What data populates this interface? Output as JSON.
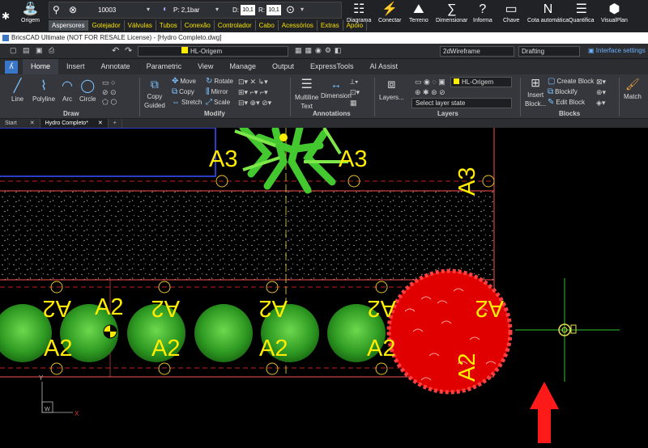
{
  "plugin": {
    "origem": "Origem",
    "pressure": "P: 2,1bar",
    "d_label": "D:",
    "d_val": "10,1",
    "r_label": "R:",
    "r_val": "10,1",
    "code": "10003",
    "tabs": [
      "Aspersores",
      "Gotejador",
      "Válvulas",
      "Tubos",
      "Conexão",
      "Controlador",
      "Cabo",
      "Acessórios",
      "Extras",
      "Apoio"
    ],
    "buttons": [
      "Diagrama",
      "Conectar",
      "Terreno",
      "Dimensionar",
      "Informa",
      "Chave",
      "Cota automática",
      "Quantifica",
      "VisualPlan"
    ]
  },
  "window_title": "BricsCAD Ultimate (NOT FOR RESALE License) - [Hydro Completo.dwg]",
  "qat": {
    "layer": "HL-Origem",
    "visual_style": "2dWireframe",
    "workspace": "Drafting",
    "interface": "Interface settings"
  },
  "ribbon_tabs": [
    "Home",
    "Insert",
    "Annotate",
    "Parametric",
    "View",
    "Manage",
    "Output",
    "ExpressTools",
    "AI Assist"
  ],
  "ribbon": {
    "draw": {
      "label": "Draw",
      "items": [
        "Line",
        "Polyline",
        "Arc",
        "Circle"
      ]
    },
    "modify": {
      "label": "Modify",
      "copy": "Copy",
      "guided": "Guided",
      "items": [
        "Move",
        "Rotate",
        "Copy",
        "Mirror",
        "Stretch",
        "Scale"
      ]
    },
    "annotations": {
      "label": "Annotations",
      "multiline": "Multiline",
      "text": "Text",
      "dimension": "Dimension"
    },
    "layers": {
      "label": "Layers",
      "layers_btn": "Layers...",
      "current": "HL-Origem",
      "state": "Select layer state"
    },
    "blocks": {
      "label": "Blocks",
      "insert": "Insert",
      "block": "Block...",
      "create": "Create Block",
      "blockify": "Blockify",
      "edit": "Edit Block"
    },
    "match": "Match"
  },
  "doc_tabs": [
    "Start",
    "Hydro Completo*"
  ],
  "labels": {
    "a3": "A3",
    "a2": "A2"
  },
  "axis": {
    "y": "Y",
    "x": "X",
    "w": "W"
  }
}
